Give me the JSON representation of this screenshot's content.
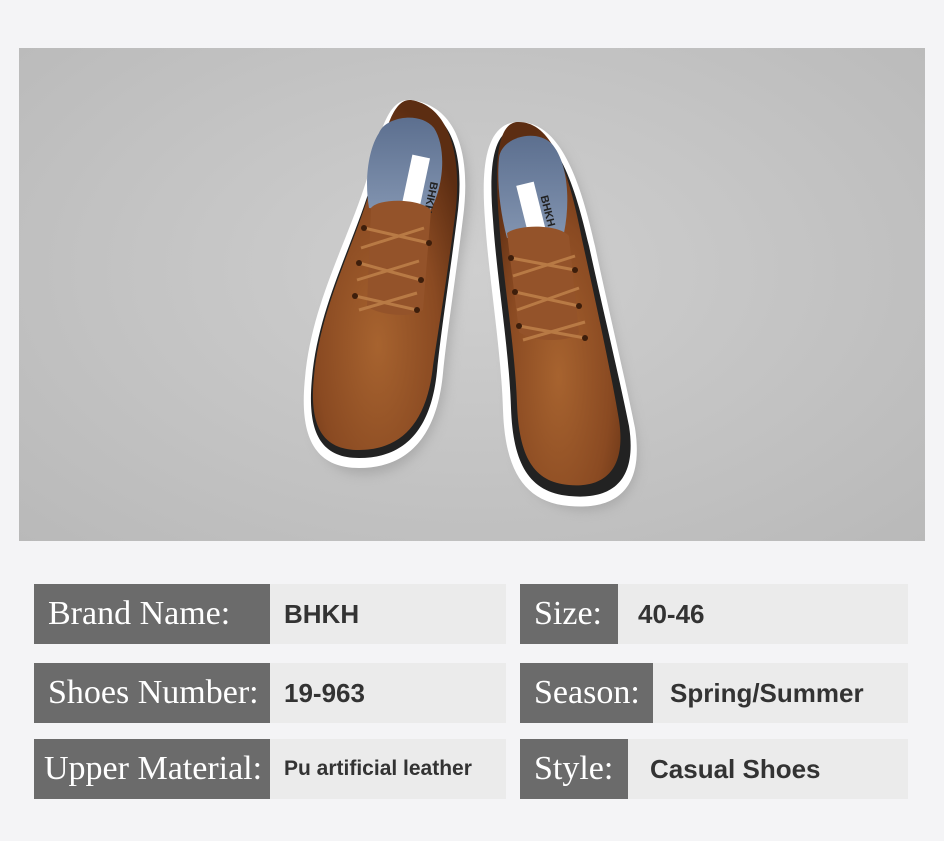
{
  "product": {
    "image_alt": "Pair of brown lace-up casual shoes with white soles",
    "insole_brand": "BHKH",
    "colors": {
      "background": "#f4f4f6",
      "label_bg": "#6b6b6b",
      "value_bg": "#ebebeb",
      "leather": "#8a4a22"
    }
  },
  "specs": {
    "brand": {
      "label": "Brand Name:",
      "value": "BHKH"
    },
    "size": {
      "label": "Size:",
      "value": "40-46"
    },
    "number": {
      "label": "Shoes Number:",
      "value": "19-963"
    },
    "season": {
      "label": "Season:",
      "value": "Spring/Summer"
    },
    "material": {
      "label": "Upper Material:",
      "value": "Pu artificial leather"
    },
    "style": {
      "label": "Style:",
      "value": "Casual Shoes"
    }
  }
}
